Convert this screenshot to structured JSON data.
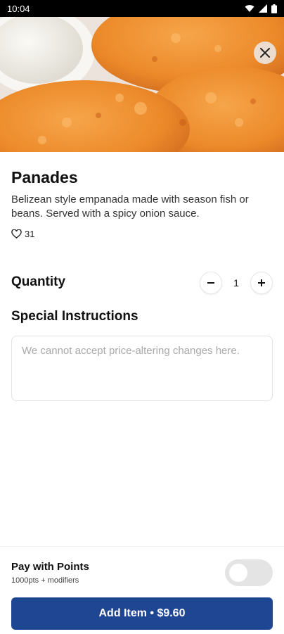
{
  "status_bar": {
    "time": "10:04"
  },
  "item": {
    "name": "Panades",
    "description": "Belizean style empanada made with season fish or beans. Served with a spicy onion sauce.",
    "likes": "31"
  },
  "quantity": {
    "label": "Quantity",
    "value": "1"
  },
  "special_instructions": {
    "label": "Special Instructions",
    "placeholder": "We cannot accept price-altering changes here."
  },
  "points": {
    "label": "Pay with Points",
    "subtitle": "1000pts + modifiers",
    "enabled": false
  },
  "add_button": {
    "label": "Add Item • $9.60"
  },
  "colors": {
    "primary": "#1e4692",
    "toggle_off": "#e4e4e4"
  },
  "icons": [
    "wifi-icon",
    "signal-icon",
    "battery-icon",
    "close-icon",
    "heart-icon",
    "minus-icon",
    "plus-icon"
  ]
}
